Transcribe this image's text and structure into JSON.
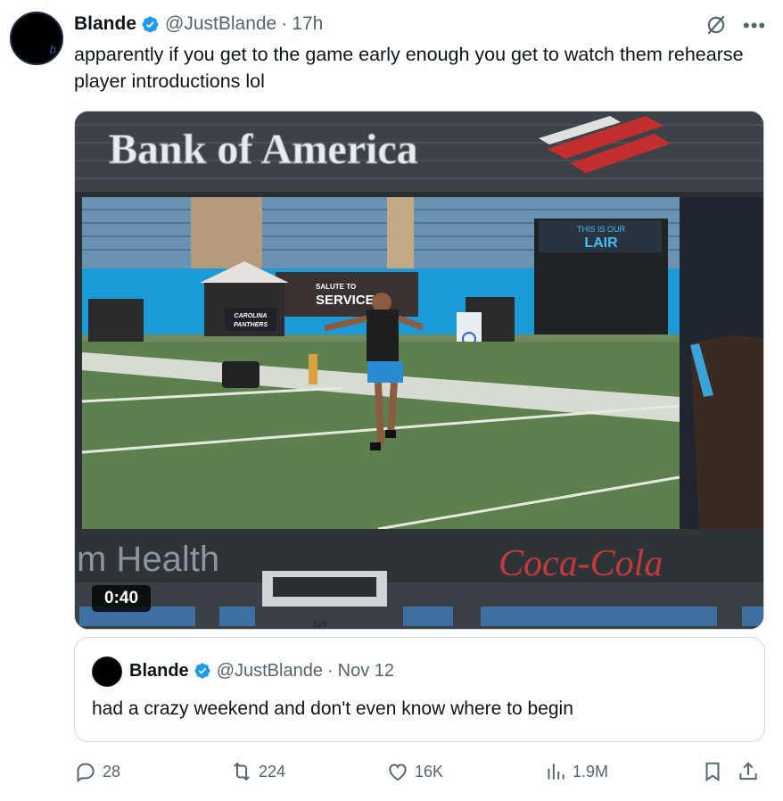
{
  "tweet": {
    "author_name": "Blande",
    "handle": "@JustBlande",
    "separator": "·",
    "time": "17h",
    "text": "apparently if you get to the game early enough you get to watch them rehearse player introductions lol",
    "avatar_icon": "avatar-icon"
  },
  "media": {
    "duration": "0:40",
    "scene_text": {
      "bank_sign": "Bank of America",
      "health_sign": "m Health",
      "coke_sign": "Coca-Cola",
      "tunnel_sign_1": "THIS IS OUR",
      "tunnel_sign_2": "LAIR",
      "banner_1": "SALUTE TO",
      "banner_2": "SERVICE",
      "panthers_1": "CAROLINA",
      "panthers_2": "PANTHERS",
      "section_number": "528"
    }
  },
  "quote": {
    "author_name": "Blande",
    "handle": "@JustBlande",
    "separator": "·",
    "date": "Nov 12",
    "text": "had a crazy weekend and don't even know where to begin"
  },
  "actions": {
    "replies": "28",
    "reposts": "224",
    "likes": "16K",
    "views": "1.9M"
  },
  "colors": {
    "verified": "#1d9bf0",
    "secondary_text": "#536471",
    "border": "#cfd9de",
    "field_green": "#5e7f4e",
    "panthers_blue": "#1a9ad6"
  }
}
